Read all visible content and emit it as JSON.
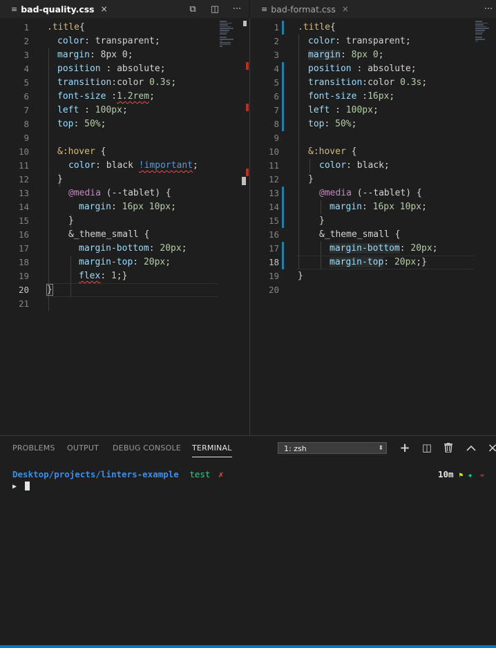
{
  "tabs": [
    {
      "name": "bad-quality.css",
      "close": "×",
      "icon": "≡"
    },
    {
      "name": "bad-format.css",
      "close": "×",
      "icon": "≡"
    }
  ],
  "tab_actions": {
    "split": "◫",
    "more": "···",
    "diff": "⧉"
  },
  "left_editor": {
    "line_numbers": [
      "1",
      "2",
      "3",
      "4",
      "5",
      "6",
      "7",
      "8",
      "9",
      "10",
      "11",
      "12",
      "13",
      "14",
      "15",
      "16",
      "17",
      "18",
      "19",
      "20",
      "21"
    ],
    "current_line": "20"
  },
  "right_editor": {
    "line_numbers": [
      "1",
      "2",
      "3",
      "4",
      "5",
      "6",
      "7",
      "8",
      "9",
      "10",
      "11",
      "12",
      "13",
      "14",
      "15",
      "16",
      "17",
      "18",
      "19",
      "20"
    ],
    "current_line": "18"
  },
  "code_left": {
    "l1_sel": ".title",
    "l1_brace": "{",
    "l2_prop": "color",
    "l2_rest": ": transparent;",
    "l3_prop": "margin",
    "l3_val": ": 8px 0;",
    "l4_prop": "position",
    "l4_rest": " : absolute;",
    "l5_prop": "transition",
    "l5_rest": ":color ",
    "l5_num": "0.3s",
    "l5_end": ";",
    "l6_prop": "font-size",
    "l6_rest": " :",
    "l6_num": "1.2rem",
    "l6_end": ";",
    "l7_prop": "left",
    "l7_rest": " : ",
    "l7_num": "100px",
    "l7_end": ";",
    "l8_prop": "top",
    "l8_rest": ": ",
    "l8_num": "50%",
    "l8_end": ";",
    "l10_sel": "&:hover",
    "l10_end": " {",
    "l11_prop": "color",
    "l11_rest": ": black ",
    "l11_imp": "!important",
    "l11_end": ";",
    "l12": "}",
    "l13_kw": "@media",
    "l13_rest": " (--tablet) {",
    "l14_prop": "margin",
    "l14_rest": ": ",
    "l14_num": "16px 10px",
    "l14_end": ";",
    "l15": "}",
    "l16_sel": "&_theme_small",
    "l16_end": " {",
    "l17_prop": "margin-bottom",
    "l17_rest": ": ",
    "l17_num": "20px",
    "l17_end": ";",
    "l18_prop": "margin-top",
    "l18_rest": ": ",
    "l18_num": "20px",
    "l18_end": ";",
    "l19_prop": "flex",
    "l19_rest": ": ",
    "l19_num": "1",
    "l19_end": ";}",
    "l20": "}"
  },
  "code_right": {
    "l1_sel": ".title",
    "l1_brace": "{",
    "l2_prop": "color",
    "l2_rest": ": transparent;",
    "l3_prop": "margin",
    "l3_rest": ": ",
    "l3_num": "8px 0",
    "l3_end": ";",
    "l4_prop": "position",
    "l4_rest": " : absolute;",
    "l5_prop": "transition",
    "l5_rest": ":color ",
    "l5_num": "0.3s",
    "l5_end": ";",
    "l6_prop": "font-size",
    "l6_rest": " :",
    "l6_num": "16px",
    "l6_end": ";",
    "l7_prop": "left",
    "l7_rest": " : ",
    "l7_num": "100px",
    "l7_end": ";",
    "l8_prop": "top",
    "l8_rest": ": ",
    "l8_num": "50%",
    "l8_end": ";",
    "l10_sel": "&:hover",
    "l10_end": " {",
    "l11_prop": "color",
    "l11_rest": ": black;",
    "l12": "}",
    "l13_kw": "@media",
    "l13_rest": " (--tablet) {",
    "l14_prop": "margin",
    "l14_rest": ": ",
    "l14_num": "16px 10px",
    "l14_end": ";",
    "l15": "}",
    "l16_sel": "&_theme_small",
    "l16_end": " {",
    "l17_prop": "margin-bottom",
    "l17_rest": ": ",
    "l17_num": "20px",
    "l17_end": ";",
    "l18_prop": "margin-top",
    "l18_rest": ": ",
    "l18_num": "20px",
    "l18_end": ";}",
    "l19": "}"
  },
  "panel": {
    "tabs": [
      "PROBLEMS",
      "OUTPUT",
      "DEBUG CONSOLE",
      "TERMINAL"
    ],
    "active_tab": "TERMINAL",
    "terminal_select": "1: zsh",
    "icons": {
      "add": "+",
      "split": "◫",
      "trash": "🗑",
      "up": "^",
      "close": "×"
    }
  },
  "terminal": {
    "path": "Desktop/projects/linters-example",
    "branch": "test",
    "dirty_mark": "✗",
    "prompt": "▶",
    "duration": "10m",
    "flag": "⚑",
    "plus": "✚",
    "mark": "≈"
  },
  "colors": {
    "accent": "#007acc",
    "error": "#f14c4c",
    "git_modified": "#1b81a8"
  }
}
